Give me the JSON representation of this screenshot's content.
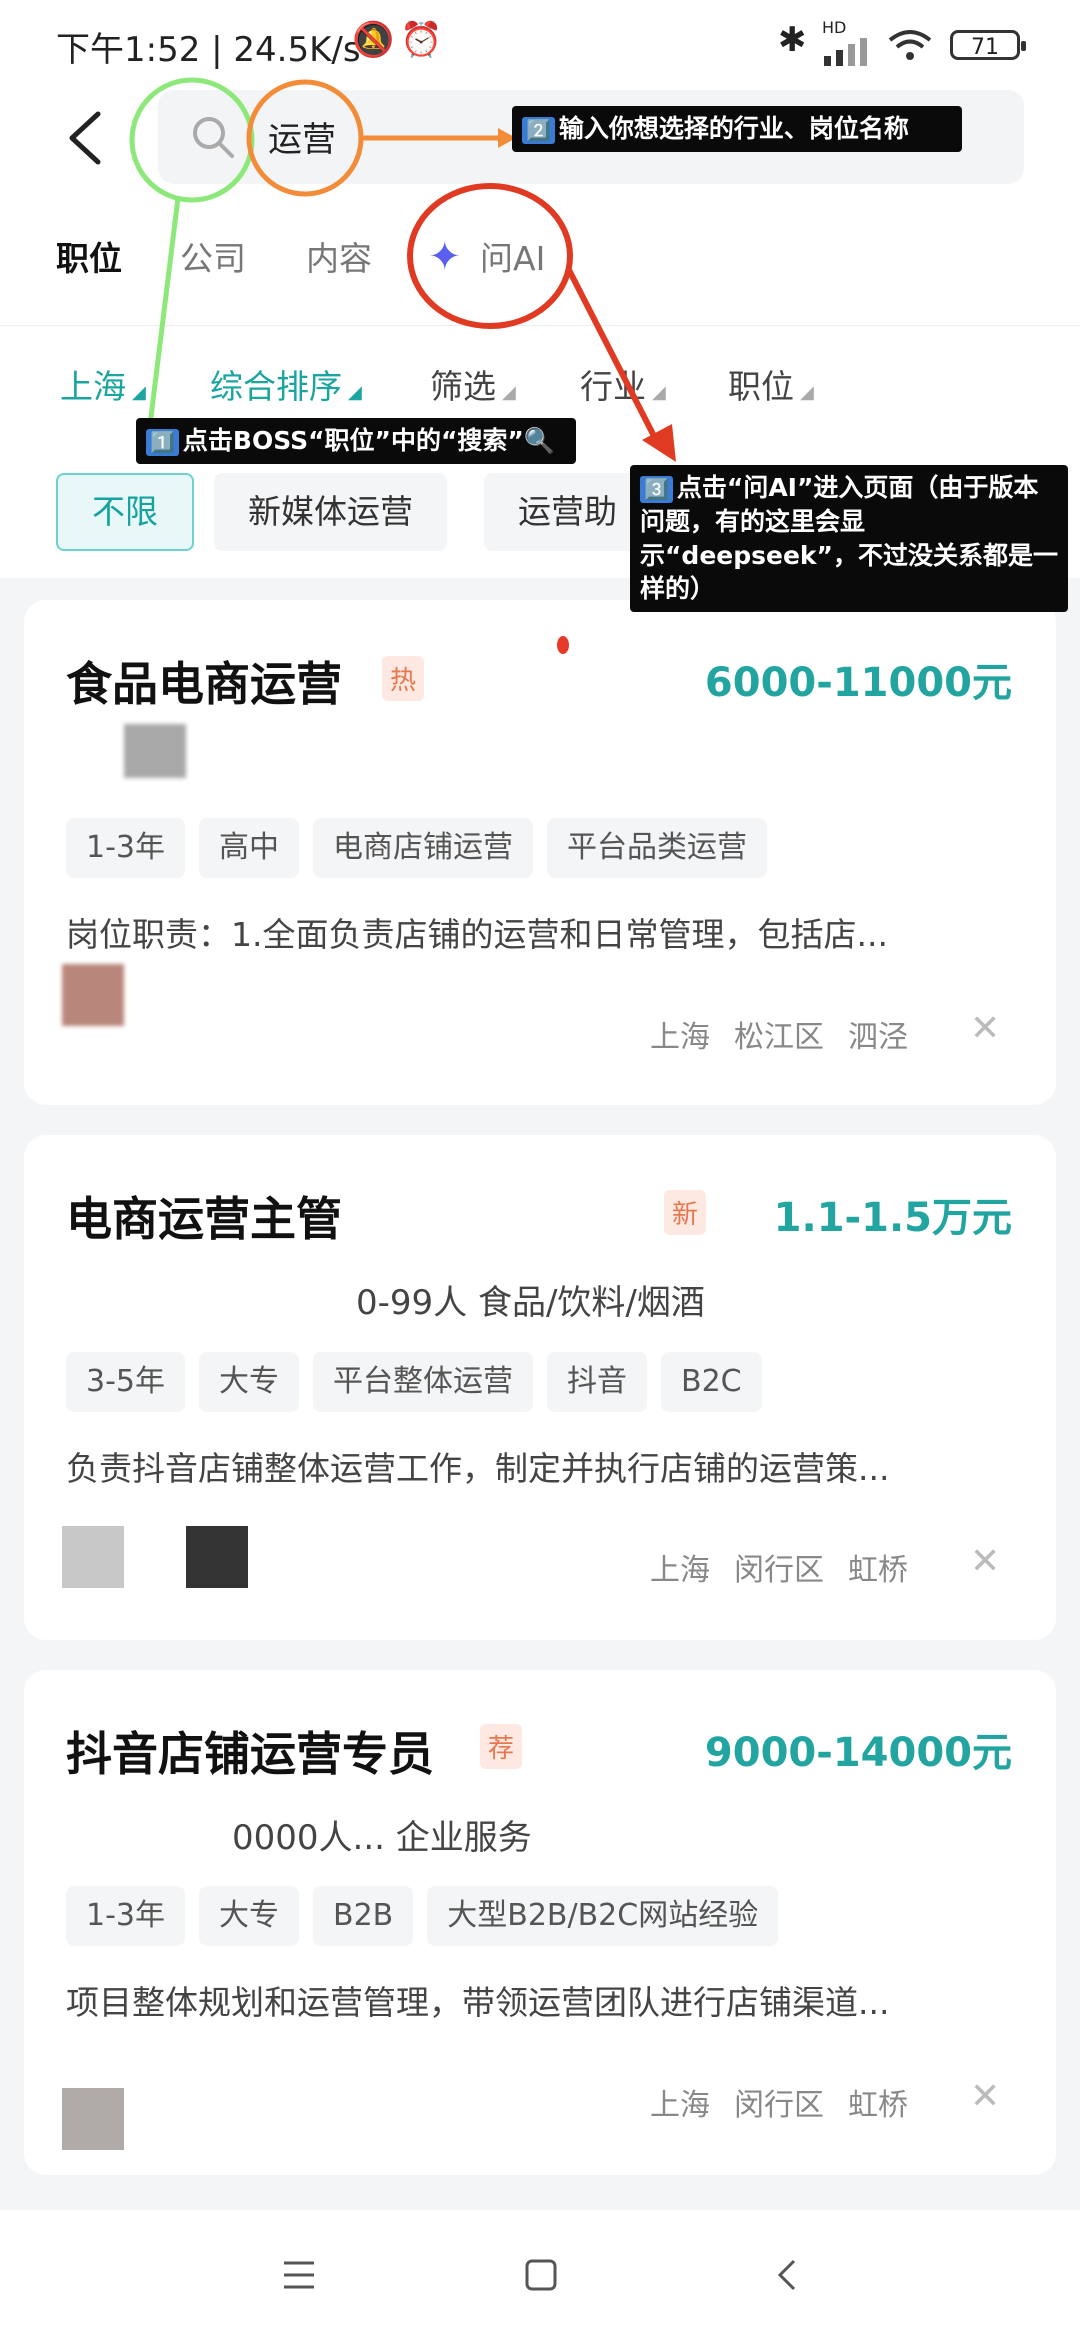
{
  "status": {
    "time_speed": "下午1:52 | 24.5K/s",
    "battery": "71",
    "signal_label": "HD"
  },
  "search": {
    "query": "运营"
  },
  "tabs": [
    {
      "label": "职位"
    },
    {
      "label": "公司"
    },
    {
      "label": "内容"
    },
    {
      "label": "问AI"
    }
  ],
  "filters": [
    {
      "label": "上海"
    },
    {
      "label": "综合排序"
    },
    {
      "label": "筛选"
    },
    {
      "label": "行业"
    },
    {
      "label": "职位"
    }
  ],
  "chips": [
    {
      "label": "不限"
    },
    {
      "label": "新媒体运营"
    },
    {
      "label": "运营助"
    }
  ],
  "jobs": [
    {
      "title": "食品电商运营",
      "badge": "热",
      "salary": "6000-11000元",
      "company": "",
      "tags": [
        "1-3年",
        "高中",
        "电商店铺运营",
        "平台品类运营"
      ],
      "desc": "岗位职责：1.全面负责店铺的运营和日常管理，包括店...",
      "city": "上海",
      "district": "松江区",
      "area": "泗泾"
    },
    {
      "title": "电商运营主管",
      "badge": "新",
      "salary": "1.1-1.5万元",
      "company": "0-99人  食品/饮料/烟酒",
      "tags": [
        "3-5年",
        "大专",
        "平台整体运营",
        "抖音",
        "B2C"
      ],
      "desc": "负责抖音店铺整体运营工作，制定并执行店铺的运营策...",
      "city": "上海",
      "district": "闵行区",
      "area": "虹桥"
    },
    {
      "title": "抖音店铺运营专员",
      "badge": "荐",
      "salary": "9000-14000元",
      "company": "0000人...  企业服务",
      "tags": [
        "1-3年",
        "大专",
        "B2B",
        "大型B2B/B2C网站经验"
      ],
      "desc": "项目整体规划和运营管理，带领运营团队进行店铺渠道...",
      "city": "上海",
      "district": "闵行区",
      "area": "虹桥"
    }
  ],
  "annotations": {
    "a1": {
      "num": "1️⃣",
      "text": "点击BOSS“职位”中的“搜索”🔍"
    },
    "a2": {
      "num": "2️⃣",
      "text": "输入你想选择的行业、岗位名称"
    },
    "a3": {
      "num": "3️⃣",
      "text": "点击“问AI”进入页面（由于版本问题，有的这里会显示“deepseek”，不过没关系都是一样的）"
    }
  },
  "colors": {
    "accent": "#1aa5a0",
    "ai": "#5b5ff0",
    "circle_green": "#8de87a",
    "circle_orange": "#f28c38",
    "circle_red": "#e03b22"
  }
}
